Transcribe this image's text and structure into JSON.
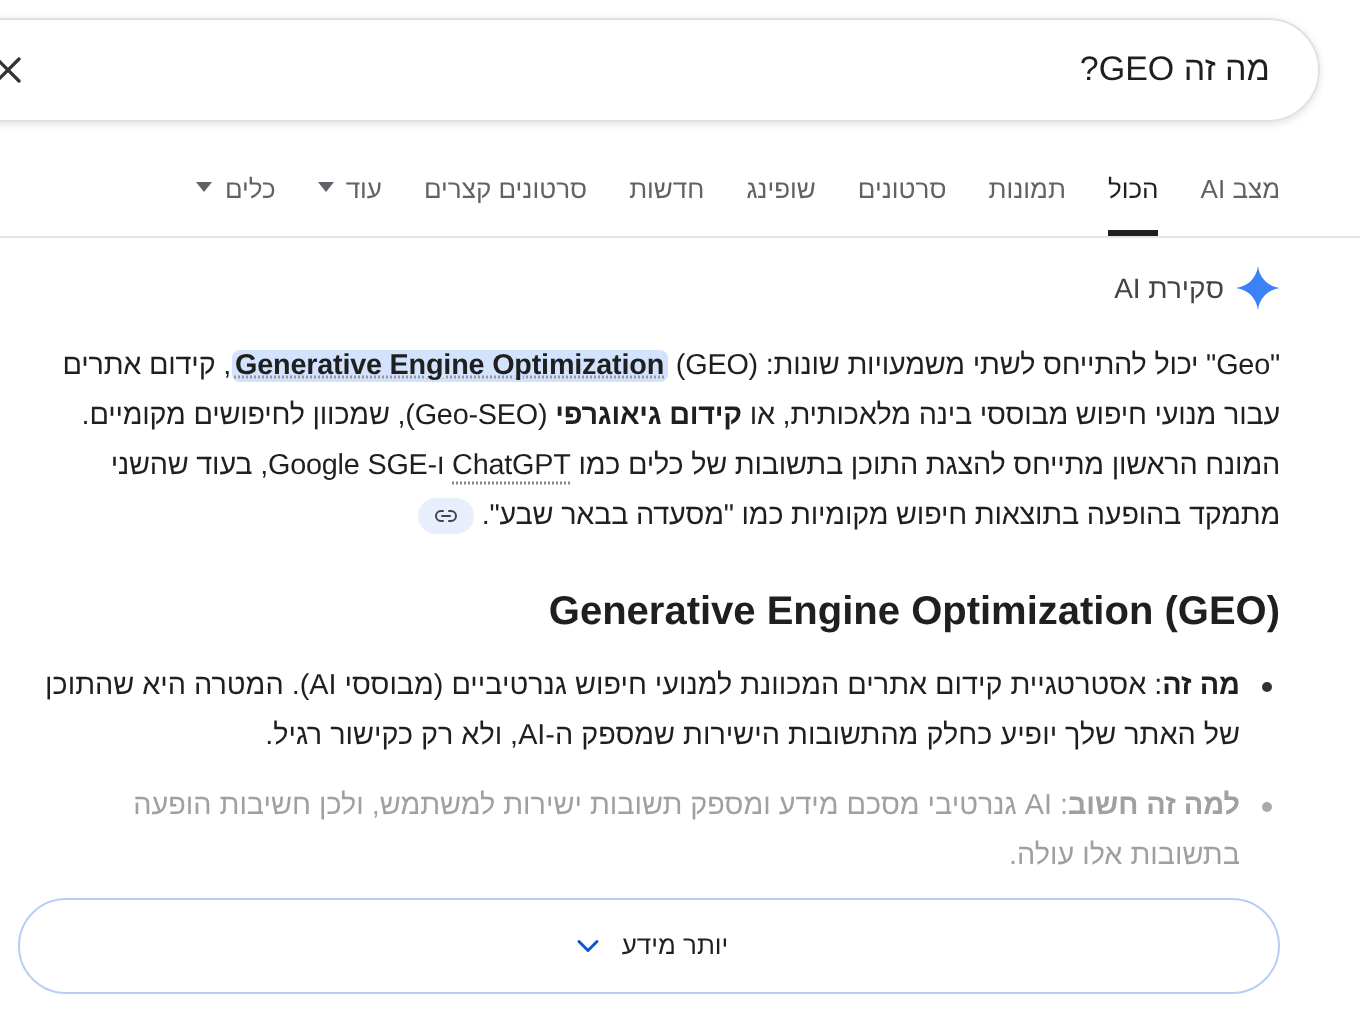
{
  "search": {
    "value": "מה זה GEO?"
  },
  "tabs": [
    {
      "label": "מצב AI",
      "selected": false,
      "kind": "tab"
    },
    {
      "label": "הכול",
      "selected": true,
      "kind": "tab"
    },
    {
      "label": "תמונות",
      "selected": false,
      "kind": "tab"
    },
    {
      "label": "סרטונים",
      "selected": false,
      "kind": "tab"
    },
    {
      "label": "שופינג",
      "selected": false,
      "kind": "tab"
    },
    {
      "label": "חדשות",
      "selected": false,
      "kind": "tab"
    },
    {
      "label": "סרטונים קצרים",
      "selected": false,
      "kind": "tab"
    },
    {
      "label": "עוד",
      "selected": false,
      "kind": "dropdown"
    },
    {
      "label": "כלים",
      "selected": false,
      "kind": "dropdown"
    }
  ],
  "overview": {
    "title": "סקירת AI",
    "paragraph": [
      {
        "kind": "text",
        "text": "\"Geo\" יכול להתייחס לשתי משמעויות שונות: (GEO) "
      },
      {
        "kind": "highlight",
        "text": "Generative Engine Optimization"
      },
      {
        "kind": "text",
        "text": ", קידום אתרים עבור מנועי חיפוש מבוססי בינה מלאכותית, או "
      },
      {
        "kind": "bold",
        "text": "קידום גיאוגרפי"
      },
      {
        "kind": "text",
        "text": " (Geo-SEO), שמכוון לחיפושים מקומיים. המונח הראשון מתייחס להצגת התוכן בתשובות של כלים כמו "
      },
      {
        "kind": "link",
        "text": "ChatGPT"
      },
      {
        "kind": "text",
        "text": " ו-Google SGE, בעוד שהשני מתמקד בהופעה בתוצאות חיפוש מקומיות כמו \"מסעדה בבאר שבע\"."
      }
    ],
    "heading": "Generative Engine Optimization (GEO)",
    "bullets": [
      {
        "text": "**מה זה**: אסטרטגיית קידום אתרים המכוונת למנועי חיפוש גנרטיביים (מבוססי AI). המטרה היא שהתוכן של האתר שלך יופיע כחלק מהתשובות הישירות שמספק ה-AI, ולא רק כקישור רגיל.",
        "faded": false
      },
      {
        "text": "**למה זה חשוב**: AI גנרטיבי מסכם מידע ומספק תשובות ישירות למשתמש, ולכן חשיבות הופעה בתשובות אלו עולה.",
        "faded": true
      }
    ],
    "more_button": "יותר מידע"
  }
}
